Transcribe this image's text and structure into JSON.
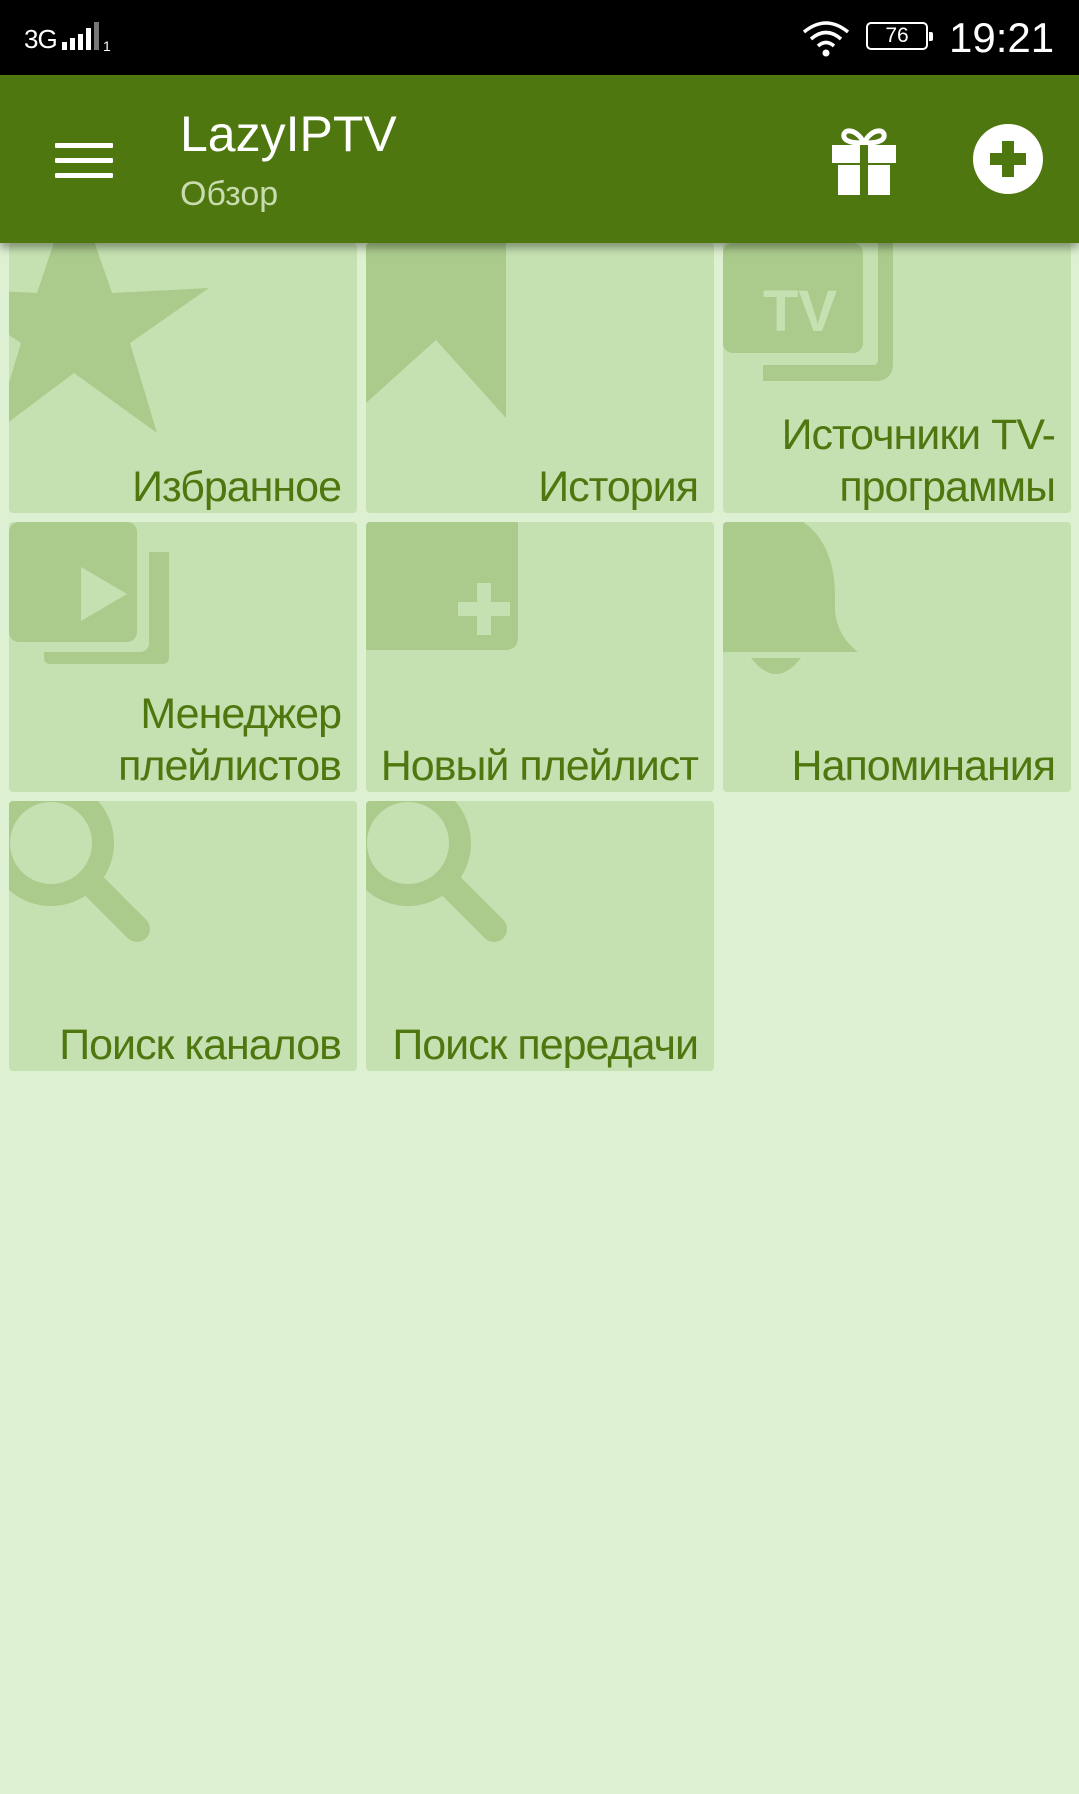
{
  "status_bar": {
    "network": "3G",
    "sim": "1",
    "battery": "76",
    "time": "19:21"
  },
  "app_bar": {
    "title": "LazyIPTV",
    "subtitle": "Обзор",
    "icons": [
      "menu-icon",
      "gift-icon",
      "add-circle-icon"
    ]
  },
  "tiles": [
    {
      "label": "Избранное",
      "icon": "star-icon"
    },
    {
      "label": "История",
      "icon": "bookmark-icon"
    },
    {
      "label": "Источники TV-программы",
      "label_line1": "Источники TV-",
      "label_line2": "программы",
      "icon": "tv-icon"
    },
    {
      "label": "Менеджер плейлистов",
      "label_line1": "Менеджер",
      "label_line2": "плейлистов",
      "icon": "playlist-play-icon"
    },
    {
      "label": "Новый плейлист",
      "icon": "playlist-add-icon"
    },
    {
      "label": "Напоминания",
      "icon": "bell-icon"
    },
    {
      "label": "Поиск каналов",
      "icon": "search-icon"
    },
    {
      "label": "Поиск передачи",
      "icon": "search-icon"
    }
  ],
  "colors": {
    "app_bar": "#4e7710",
    "background": "#ddf0d1",
    "tile": "#c5e1b1",
    "tile_icon": "#aacb8c",
    "tile_text": "#4e7710"
  }
}
